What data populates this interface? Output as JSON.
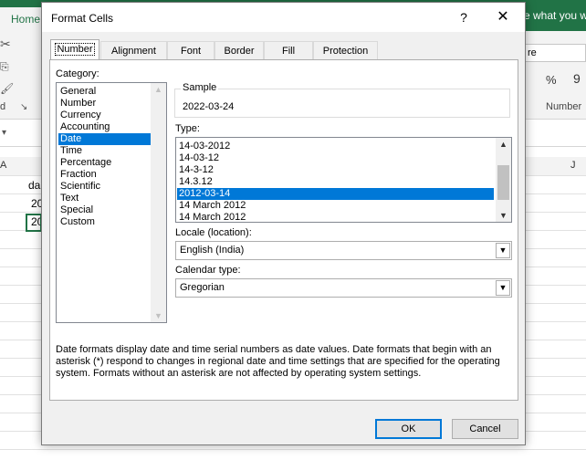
{
  "excel": {
    "home_tab": "Home",
    "tell_me": "e what you w",
    "number_format_partial": "re",
    "percent_symbol": "%",
    "comma_symbol": "9",
    "group_number_label": "Number",
    "group_left_label": "d",
    "col_a": "A",
    "col_j": "J",
    "cell_a1_partial": "da",
    "cell_a2_partial": "20",
    "cell_a3_partial": "20"
  },
  "dialog": {
    "title": "Format Cells",
    "help_label": "?",
    "close_label": "✕",
    "tabs": [
      "Number",
      "Alignment",
      "Font",
      "Border",
      "Fill",
      "Protection"
    ],
    "category_label": "Category:",
    "categories": [
      "General",
      "Number",
      "Currency",
      "Accounting",
      "Date",
      "Time",
      "Percentage",
      "Fraction",
      "Scientific",
      "Text",
      "Special",
      "Custom"
    ],
    "selected_category": "Date",
    "sample_label": "Sample",
    "sample_value": "2022-03-24",
    "type_label": "Type:",
    "types": [
      "14-03-2012",
      "14-03-12",
      "14-3-12",
      "14.3.12",
      "2012-03-14",
      "14 March 2012",
      "14 March 2012"
    ],
    "selected_type": "2012-03-14",
    "locale_label": "Locale (location):",
    "locale_value": "English (India)",
    "calendar_label": "Calendar type:",
    "calendar_value": "Gregorian",
    "description": "Date formats display date and time serial numbers as date values.  Date formats that begin with an asterisk (*) respond to changes in regional date and time settings that are specified for the operating system. Formats without an asterisk are not affected by operating system settings.",
    "ok_label": "OK",
    "cancel_label": "Cancel"
  },
  "colors": {
    "excel_green": "#217346",
    "selection_blue": "#0078d7",
    "dialog_bg": "#f0f0f0"
  }
}
